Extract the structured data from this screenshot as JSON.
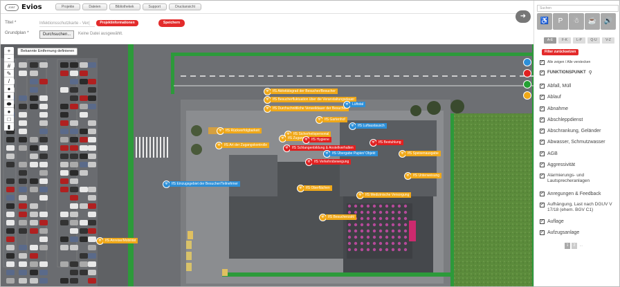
{
  "header": {
    "logo_badge": "JOBT",
    "logo_text": "Evios",
    "nav": [
      "Projekte",
      "Dateien",
      "Bibliothekek",
      "Support",
      "Druckansicht"
    ],
    "next_icon": "arrow-right-icon"
  },
  "form": {
    "title_label": "Titel *",
    "title_value": "Infektionsschutzkarte - Ver(",
    "project_info": "Projektinformationen",
    "save_label": "Speichern",
    "plan_label": "Grundplan *",
    "browse_label": "Durchsuchen...",
    "no_file": "Keine Datei ausgewählt."
  },
  "map": {
    "tools": [
      "+",
      "−",
      "#",
      "✎",
      "/",
      "●",
      "■",
      "⬬",
      "●",
      "□",
      "▮"
    ],
    "distance_button": "Bekannte Entfernung definieren",
    "colors": [
      "#2c8fd8",
      "#e02020",
      "#23a033",
      "#f0a818"
    ],
    "markers": [
      {
        "label": "IfS Aktivitätsgrad der Besucher/Besucher",
        "c": "o"
      },
      {
        "label": "IfS Besucherfluktuation über die Veranstaltungsdauer",
        "c": "o"
      },
      {
        "label": "IfS Durchschnittliche Verweildauer der Besucher",
        "c": "o"
      },
      {
        "label": "Lüftstal",
        "c": "b"
      },
      {
        "label": "IfS Gartenhof",
        "c": "o"
      },
      {
        "label": "IfS Luftaustausch",
        "c": "b"
      },
      {
        "label": "IfS Rückverfolgbarkeit",
        "c": "o"
      },
      {
        "label": "IfS Sicherheitspersonal",
        "c": "o"
      },
      {
        "label": "IfS Zugang",
        "c": "o"
      },
      {
        "label": "IfS Hygiene",
        "c": "r"
      },
      {
        "label": "IfS Bestuhlung",
        "c": "r"
      },
      {
        "label": "IfS Art der Zugangskontrolle",
        "c": "o"
      },
      {
        "label": "IfS Schlangenbildung & Anstellverhalten",
        "c": "r"
      },
      {
        "label": "IfS Übergabe Papier/ Objekt",
        "c": "b"
      },
      {
        "label": "IfS Speisenausgabe",
        "c": "o"
      },
      {
        "label": "IfS Verkehrsbewegung",
        "c": "r"
      },
      {
        "label": "IfS Unterweisung",
        "c": "o"
      },
      {
        "label": "IfS Einzugsgebiet der Besucher/Teilnehmer",
        "c": "b"
      },
      {
        "label": "IfS Oberflächen",
        "c": "o"
      },
      {
        "label": "IfS Medizinische Versorgung",
        "c": "o"
      },
      {
        "label": "IfS Besucherzahl",
        "c": "o"
      },
      {
        "label": "IfS Anreise/Mobilität",
        "c": "o"
      }
    ]
  },
  "sidebar": {
    "search_placeholder": "Suchen",
    "tiles": [
      "♿",
      "P",
      "☃",
      "☕",
      "🔊"
    ],
    "letters": [
      "A-E",
      "F-K",
      "L-P",
      "Q-U",
      "V-Z"
    ],
    "reset_label": "Filter zurücksetzen",
    "show_hide": "Alle zeigen / Alle verstecken",
    "funktionspunkt": "FUNKTIONSPUNKT",
    "categories": [
      "Abfall, Müll",
      "Ablauf",
      "Abnahme",
      "Abschleppdienst",
      "Abschrankung, Geländer",
      "Abwasser, Schmutzwasser",
      "AGB",
      "Aggressivität",
      "Alarmierungs- und Lautsprecheranlagen",
      "Anregungen & Feedback",
      "Aufhängung, Last nach DGUV V 17/18 (ehem. BGV C1)",
      "Auflage",
      "Aufzugsanlage"
    ],
    "pages": [
      "1",
      "2",
      "..."
    ]
  }
}
